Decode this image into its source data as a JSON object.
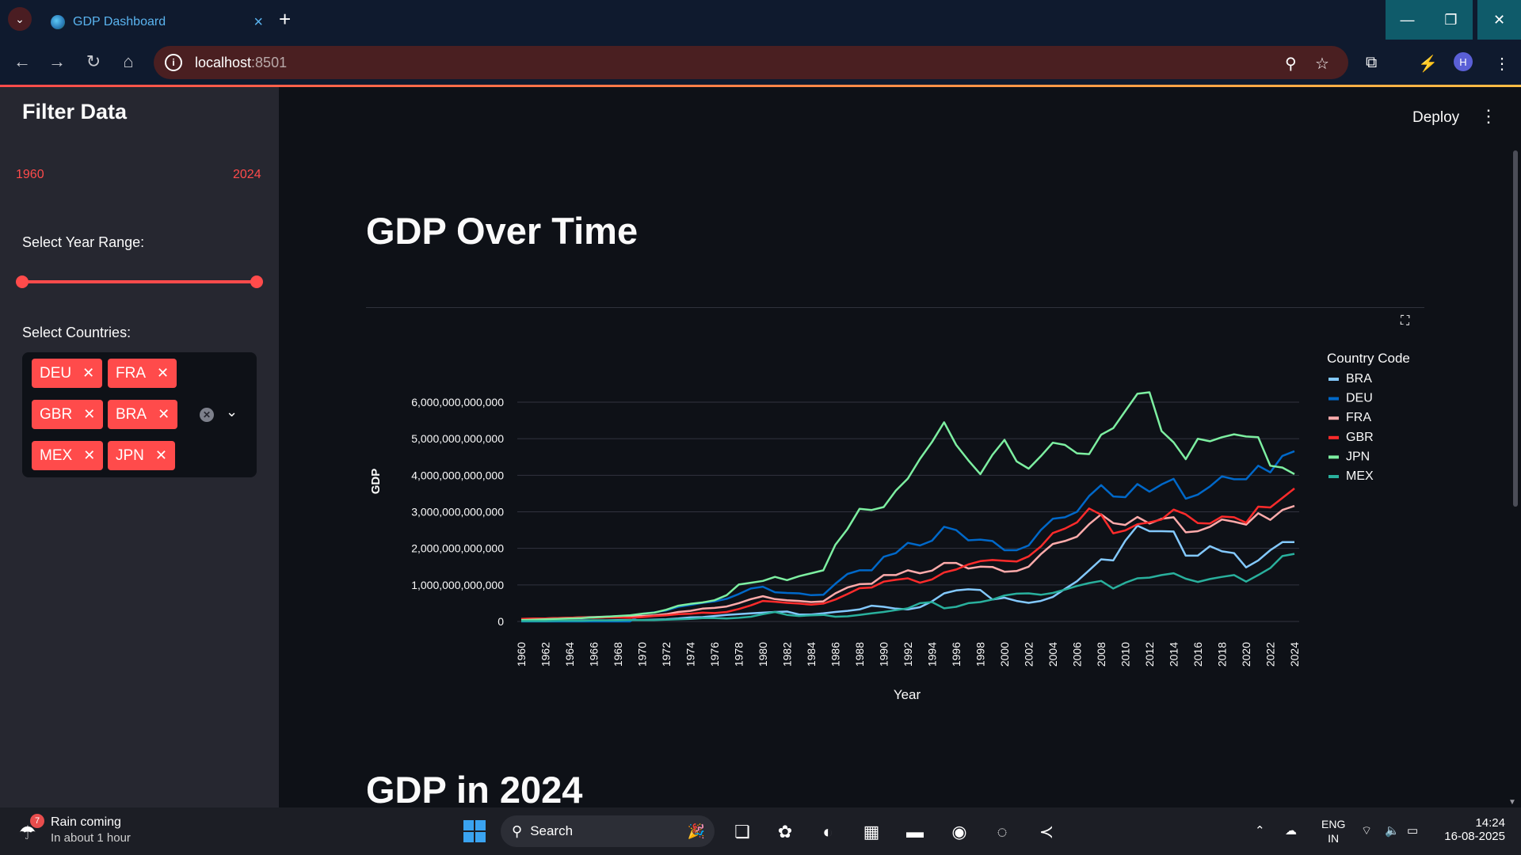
{
  "browser": {
    "tab_title": "GDP Dashboard",
    "url_host": "localhost",
    "url_port": ":8501",
    "profile_initial": "H"
  },
  "app": {
    "deploy_label": "Deploy"
  },
  "sidebar": {
    "title": "Filter Data",
    "year_range_label": "Select Year Range:",
    "year_min": "1960",
    "year_max": "2024",
    "countries_label": "Select Countries:",
    "selected_countries": [
      "DEU",
      "FRA",
      "GBR",
      "BRA",
      "MEX",
      "JPN"
    ]
  },
  "main": {
    "title": "GDP Over Time",
    "next_title": "GDP in 2024"
  },
  "chart_data": {
    "type": "line",
    "xlabel": "Year",
    "ylabel": "GDP",
    "legend_title": "Country Code",
    "legend_position": "right",
    "ylim": [
      0,
      6300000000000
    ],
    "y_ticks": [
      "0",
      "1,000,000,000,000",
      "2,000,000,000,000",
      "3,000,000,000,000",
      "4,000,000,000,000",
      "5,000,000,000,000",
      "6,000,000,000,000"
    ],
    "x_ticks": [
      "1960",
      "1962",
      "1964",
      "1966",
      "1968",
      "1970",
      "1972",
      "1974",
      "1976",
      "1978",
      "1980",
      "1982",
      "1984",
      "1986",
      "1988",
      "1990",
      "1992",
      "1994",
      "1996",
      "1998",
      "2000",
      "2002",
      "2004",
      "2006",
      "2008",
      "2010",
      "2012",
      "2014",
      "2016",
      "2018",
      "2020",
      "2022",
      "2024"
    ],
    "x_start": 1960,
    "grid": true,
    "series": [
      {
        "name": "BRA",
        "color": "#83c9ff",
        "values": [
          0.02,
          0.02,
          0.02,
          0.02,
          0.02,
          0.03,
          0.03,
          0.03,
          0.04,
          0.04,
          0.04,
          0.05,
          0.06,
          0.08,
          0.11,
          0.12,
          0.15,
          0.18,
          0.2,
          0.22,
          0.24,
          0.26,
          0.27,
          0.19,
          0.19,
          0.22,
          0.26,
          0.29,
          0.33,
          0.43,
          0.4,
          0.35,
          0.33,
          0.39,
          0.55,
          0.77,
          0.85,
          0.88,
          0.86,
          0.6,
          0.65,
          0.56,
          0.51,
          0.56,
          0.67,
          0.89,
          1.1,
          1.4,
          1.7,
          1.67,
          2.21,
          2.62,
          2.47,
          2.47,
          2.46,
          1.8,
          1.8,
          2.06,
          1.92,
          1.87,
          1.48,
          1.67,
          1.95,
          2.17,
          2.17
        ]
      },
      {
        "name": "DEU",
        "color": "#0068c9",
        "values": [
          0.0,
          0.0,
          0.0,
          0.0,
          0.0,
          0.0,
          0.0,
          0.0,
          0.0,
          0.0,
          0.21,
          0.25,
          0.3,
          0.4,
          0.45,
          0.51,
          0.55,
          0.62,
          0.75,
          0.9,
          0.95,
          0.8,
          0.78,
          0.77,
          0.72,
          0.73,
          1.03,
          1.3,
          1.4,
          1.4,
          1.77,
          1.87,
          2.15,
          2.08,
          2.21,
          2.59,
          2.5,
          2.22,
          2.24,
          2.2,
          1.95,
          1.95,
          2.08,
          2.5,
          2.81,
          2.85,
          3.0,
          3.43,
          3.73,
          3.42,
          3.4,
          3.76,
          3.55,
          3.75,
          3.9,
          3.36,
          3.47,
          3.69,
          3.97,
          3.89,
          3.89,
          4.26,
          4.08,
          4.53,
          4.66
        ]
      },
      {
        "name": "FRA",
        "color": "#ffabab",
        "values": [
          0.06,
          0.07,
          0.08,
          0.09,
          0.1,
          0.11,
          0.12,
          0.13,
          0.14,
          0.16,
          0.15,
          0.17,
          0.2,
          0.26,
          0.29,
          0.35,
          0.37,
          0.41,
          0.5,
          0.61,
          0.69,
          0.61,
          0.58,
          0.56,
          0.53,
          0.55,
          0.77,
          0.93,
          1.02,
          1.03,
          1.27,
          1.27,
          1.4,
          1.32,
          1.39,
          1.6,
          1.6,
          1.45,
          1.5,
          1.49,
          1.36,
          1.38,
          1.5,
          1.84,
          2.12,
          2.2,
          2.32,
          2.66,
          2.93,
          2.69,
          2.64,
          2.86,
          2.68,
          2.81,
          2.85,
          2.44,
          2.47,
          2.59,
          2.79,
          2.73,
          2.65,
          2.96,
          2.78,
          3.05,
          3.16
        ]
      },
      {
        "name": "GBR",
        "color": "#ff2b2b",
        "values": [
          0.07,
          0.08,
          0.08,
          0.09,
          0.1,
          0.11,
          0.1,
          0.11,
          0.11,
          0.1,
          0.12,
          0.15,
          0.17,
          0.2,
          0.21,
          0.24,
          0.23,
          0.26,
          0.34,
          0.44,
          0.56,
          0.54,
          0.51,
          0.49,
          0.46,
          0.49,
          0.6,
          0.75,
          0.91,
          0.93,
          1.09,
          1.14,
          1.18,
          1.06,
          1.15,
          1.34,
          1.42,
          1.56,
          1.65,
          1.68,
          1.66,
          1.64,
          1.78,
          2.05,
          2.42,
          2.54,
          2.71,
          3.09,
          2.92,
          2.41,
          2.49,
          2.66,
          2.71,
          2.79,
          3.06,
          2.93,
          2.69,
          2.68,
          2.87,
          2.85,
          2.7,
          3.14,
          3.12,
          3.38,
          3.64
        ]
      },
      {
        "name": "JPN",
        "color": "#7defa1",
        "values": [
          0.04,
          0.05,
          0.06,
          0.07,
          0.08,
          0.09,
          0.11,
          0.13,
          0.15,
          0.17,
          0.21,
          0.24,
          0.32,
          0.43,
          0.48,
          0.52,
          0.58,
          0.72,
          1.01,
          1.06,
          1.11,
          1.22,
          1.13,
          1.24,
          1.32,
          1.4,
          2.1,
          2.53,
          3.08,
          3.05,
          3.13,
          3.58,
          3.91,
          4.45,
          4.91,
          5.45,
          4.83,
          4.41,
          4.03,
          4.56,
          4.97,
          4.38,
          4.18,
          4.52,
          4.89,
          4.83,
          4.6,
          4.58,
          5.11,
          5.29,
          5.76,
          6.23,
          6.27,
          5.21,
          4.9,
          4.44,
          5.0,
          4.93,
          5.04,
          5.12,
          5.06,
          5.04,
          4.26,
          4.21,
          4.03
        ]
      },
      {
        "name": "MEX",
        "color": "#29b09d",
        "values": [
          0.01,
          0.01,
          0.01,
          0.02,
          0.02,
          0.02,
          0.03,
          0.03,
          0.03,
          0.04,
          0.04,
          0.04,
          0.05,
          0.06,
          0.07,
          0.09,
          0.09,
          0.08,
          0.1,
          0.13,
          0.2,
          0.26,
          0.18,
          0.15,
          0.17,
          0.18,
          0.13,
          0.14,
          0.18,
          0.22,
          0.26,
          0.31,
          0.36,
          0.5,
          0.53,
          0.36,
          0.4,
          0.5,
          0.53,
          0.6,
          0.71,
          0.76,
          0.77,
          0.73,
          0.78,
          0.87,
          0.97,
          1.05,
          1.11,
          0.9,
          1.06,
          1.18,
          1.2,
          1.27,
          1.32,
          1.17,
          1.08,
          1.16,
          1.22,
          1.27,
          1.09,
          1.27,
          1.46,
          1.79,
          1.85
        ]
      }
    ]
  }
}
